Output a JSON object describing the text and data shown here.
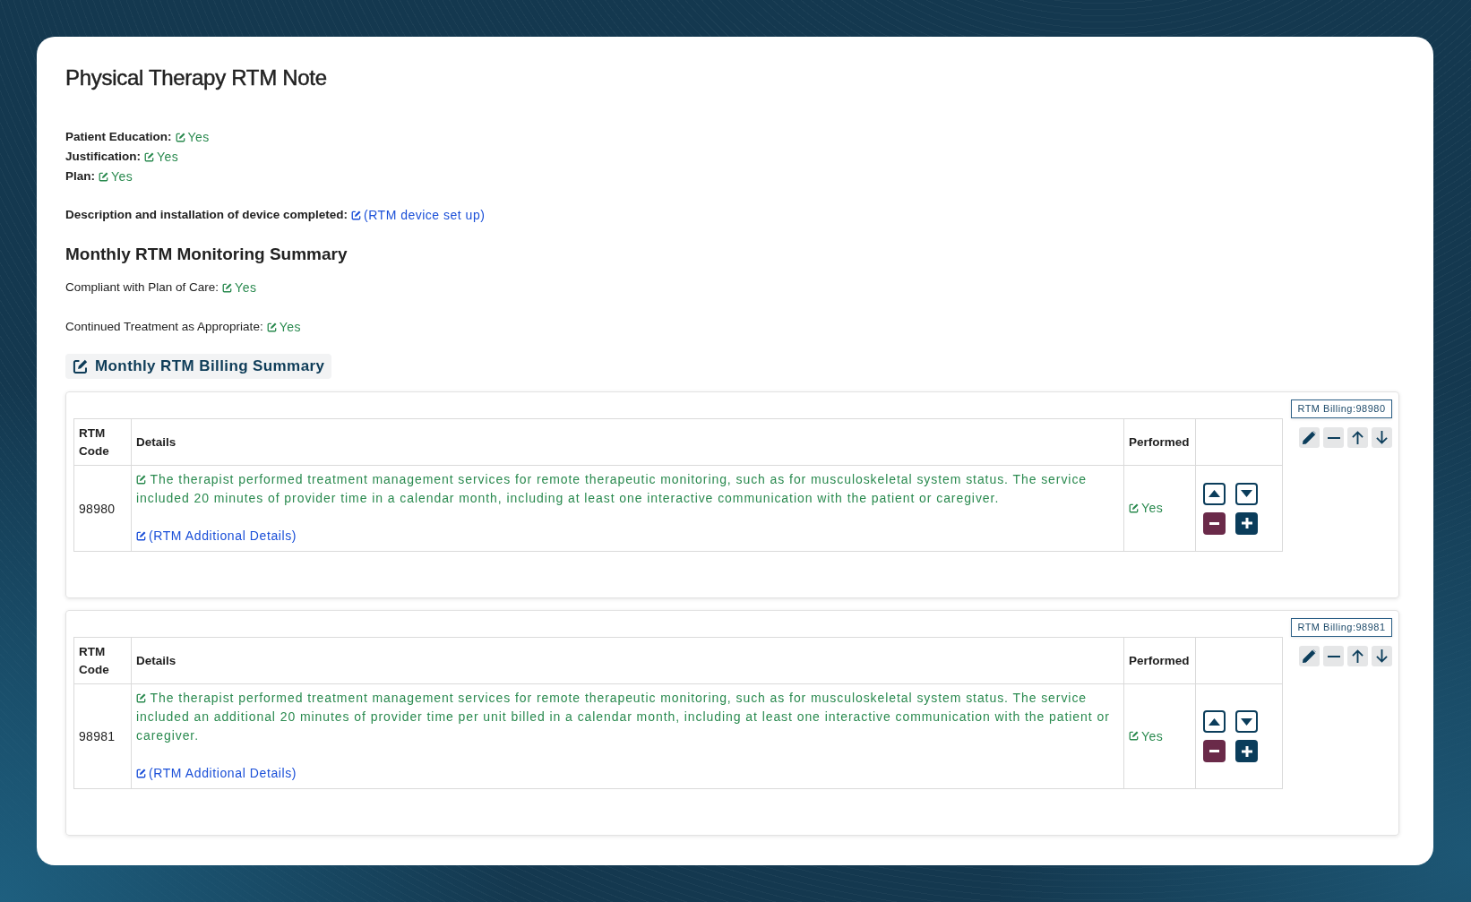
{
  "note": {
    "title": "Physical Therapy RTM Note"
  },
  "fields": [
    {
      "label": "Patient Education:",
      "value": "Yes",
      "kind": "answer"
    },
    {
      "label": "Justification:",
      "value": "Yes",
      "kind": "answer"
    },
    {
      "label": "Plan:",
      "value": "Yes",
      "kind": "answer"
    },
    {
      "label": "Description and installation of device completed:",
      "value": "(RTM device set up)",
      "kind": "link"
    }
  ],
  "monitoring": {
    "heading": "Monthly RTM Monitoring Summary",
    "fields": [
      {
        "label": "Compliant with Plan of Care:",
        "value": "Yes",
        "kind": "answer"
      },
      {
        "label": "Continued Treatment as Appropriate:",
        "value": "Yes",
        "kind": "answer"
      }
    ]
  },
  "billing": {
    "button": "Monthly RTM Billing Summary",
    "panels": [
      {
        "tag": "RTM Billing:98980",
        "columns": [
          "RTM Code",
          "Details",
          "Performed"
        ],
        "rows": [
          {
            "code": "98980",
            "details": "The therapist performed treatment management services for remote therapeutic monitoring, such as for musculoskeletal system status. The service included 20 minutes of provider time in a calendar month, including at least one interactive communication with the patient or caregiver.",
            "additional_details": "(RTM Additional Details)",
            "performed": "Yes"
          }
        ]
      },
      {
        "tag": "RTM Billing:98981",
        "columns": [
          "RTM Code",
          "Details",
          "Performed"
        ],
        "rows": [
          {
            "code": "98981",
            "details": "The therapist performed treatment management services for remote therapeutic monitoring, such as for musculoskeletal system status. The service included an additional 20 minutes of provider time per unit billed in a calendar month, including at least one interactive communication with the patient or caregiver.",
            "additional_details": "(RTM Additional Details)",
            "performed": "Yes"
          }
        ]
      }
    ]
  }
}
